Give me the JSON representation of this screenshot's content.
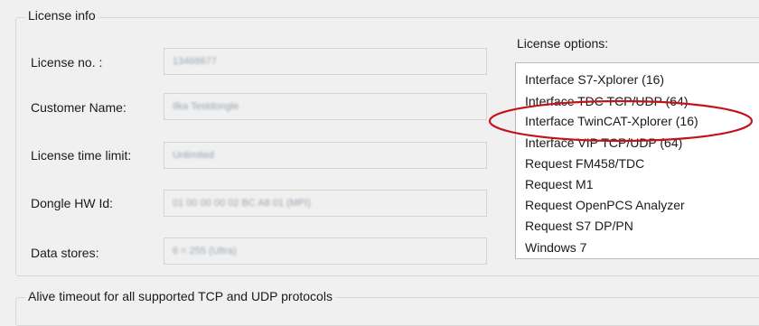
{
  "license_info": {
    "title": "License info",
    "fields": [
      {
        "label": "License no. :",
        "value": "13468677"
      },
      {
        "label": "Customer Name:",
        "value": "Ilka Testdongle"
      },
      {
        "label": "License time limit:",
        "value": "Unlimited"
      },
      {
        "label": "Dongle HW Id:",
        "value": "01 00 00 00 02 BC A8 01 (MPI)"
      },
      {
        "label": "Data stores:",
        "value": "6 = 255 (Ultra)"
      }
    ]
  },
  "license_options": {
    "label": "License options:",
    "items": [
      "Interface S7-Xplorer (16)",
      "Interface TDC TCP/UDP (64)",
      "Interface TwinCAT-Xplorer (16)",
      "Interface VIP TCP/UDP (64)",
      "Request FM458/TDC",
      "Request M1",
      "Request OpenPCS Analyzer",
      "Request S7 DP/PN",
      "Windows 7"
    ],
    "highlighted_index": 2,
    "highlight_color": "#c0141b"
  },
  "alive_timeout": {
    "title": "Alive timeout for all supported TCP and UDP protocols"
  }
}
